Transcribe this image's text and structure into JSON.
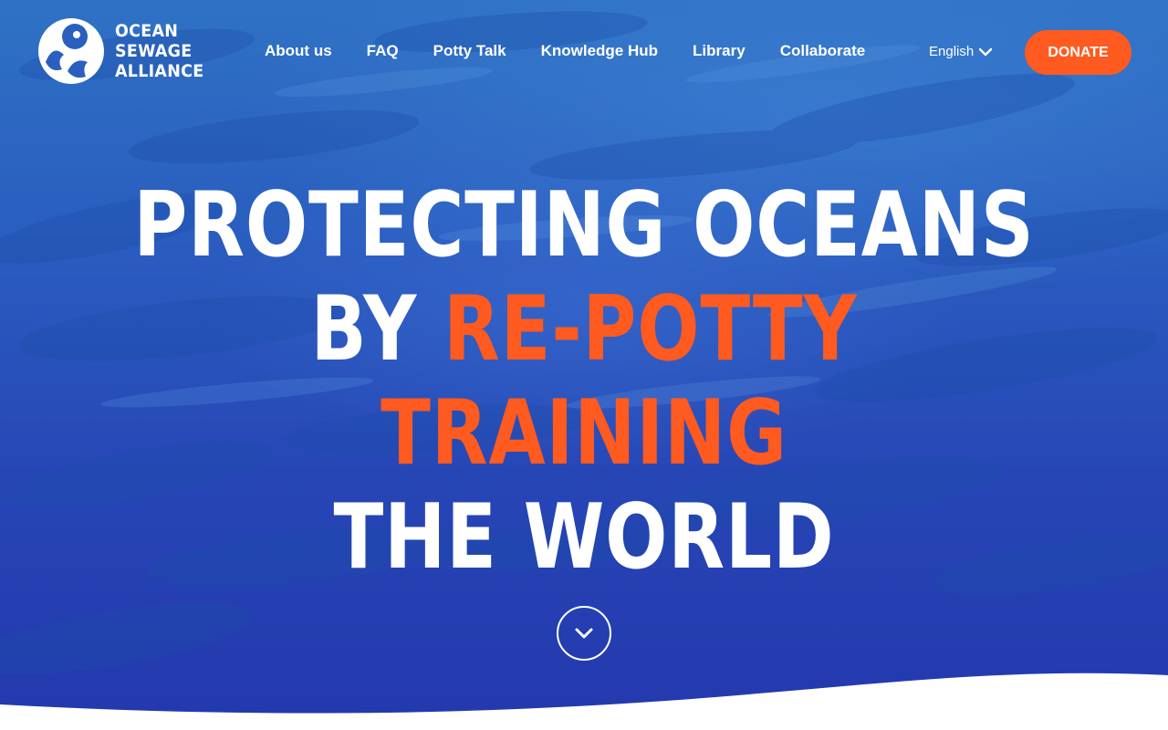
{
  "brand": {
    "name_lines": [
      "OCEAN",
      "SEWAGE",
      "ALLIANCE"
    ]
  },
  "nav": {
    "items": [
      {
        "label": "About us"
      },
      {
        "label": "FAQ"
      },
      {
        "label": "Potty Talk"
      },
      {
        "label": "Knowledge Hub"
      },
      {
        "label": "Library"
      },
      {
        "label": "Collaborate"
      }
    ]
  },
  "language": {
    "selected": "English"
  },
  "donate": {
    "label": "DONATE"
  },
  "hero": {
    "line1": "PROTECTING OCEANS",
    "line2_prefix": "BY ",
    "line2_accent": "RE-POTTY TRAINING",
    "line3": "THE WORLD"
  },
  "icons": {
    "logo": "octopus-wave-logo-icon",
    "language_chevron": "chevron-down-icon",
    "scroll": "chevron-down-icon"
  },
  "colors": {
    "accent": "#ff5a1f",
    "ocean": "#2a5fc0",
    "text": "#ffffff"
  }
}
